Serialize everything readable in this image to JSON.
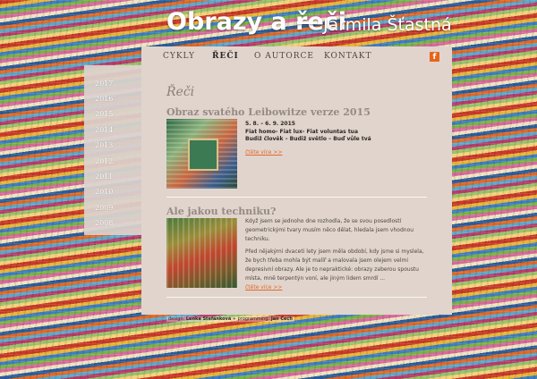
{
  "header": {
    "title": "Obrazy a řeči",
    "author": "Jarmila Šťastná"
  },
  "nav": {
    "items": [
      {
        "label": "CYKLY"
      },
      {
        "label": "ŘEČI"
      },
      {
        "label": "O AUTORCE"
      },
      {
        "label": "KONTAKT"
      }
    ],
    "active": "ŘEČI",
    "facebook_icon": "facebook-icon",
    "facebook_glyph": "f"
  },
  "sidebar": {
    "years": [
      "2017",
      "2016",
      "2015",
      "2014",
      "2013",
      "2012",
      "2011",
      "2010",
      "2009",
      "2008"
    ]
  },
  "main": {
    "page_title": "Řeči",
    "articles": [
      {
        "title": "Obraz svatého Leibowitze verze 2015",
        "date": "5. 8. – 6. 9. 2015",
        "lines": [
          "Fiat homo- Fiat lux- Fiat voluntas tua",
          "Budiž člověk – Budiž světlo – Buď vůle tvá"
        ],
        "more": "čtěte více >>"
      },
      {
        "title": "Ale jakou techniku?",
        "paragraph1": "Když jsem se jednoho dne rozhodla, že se svou posedlostí geometrickými tvary musím něco dělat, hledala jsem vhodnou techniku.",
        "paragraph2": "Před nějakými dvaceti lety jsem měla období, kdy jsme si myslela, že bych třeba mohla být malíř a malovala jsem olejem velmi depresivní obrazy. Ale je to nepraktické: obrazy zaberou spoustu místa, mně terpentýn voní, ale jiným lidem smrdí ...",
        "more": "čtěte více >>"
      }
    ]
  },
  "footer": {
    "design_label": "design:",
    "designer": "Lenka Stefánková",
    "coding_label": "+ programming:",
    "coder": "Jan Cech"
  }
}
